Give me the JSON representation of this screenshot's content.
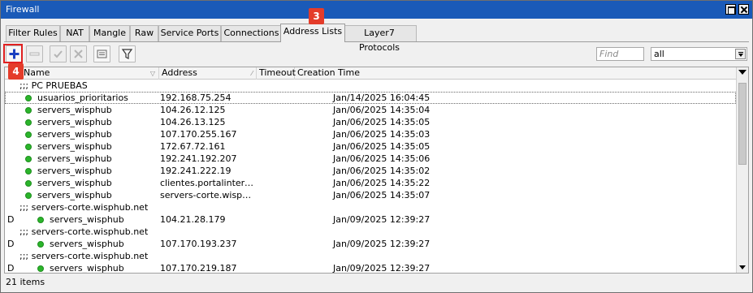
{
  "window": {
    "title": "Firewall"
  },
  "tabs": [
    {
      "label": "Filter Rules"
    },
    {
      "label": "NAT"
    },
    {
      "label": "Mangle"
    },
    {
      "label": "Raw"
    },
    {
      "label": "Service Ports"
    },
    {
      "label": "Connections"
    },
    {
      "label": "Address Lists",
      "active": true
    },
    {
      "label": "Layer7 Protocols"
    }
  ],
  "toolbar": {
    "find_placeholder": "Find",
    "filter_value": "all",
    "icons": [
      "add-icon",
      "remove-icon",
      "enable-icon",
      "disable-icon",
      "comment-icon",
      "filter-icon"
    ]
  },
  "annotations": {
    "tab_badge": "3",
    "add_badge": "4"
  },
  "table": {
    "columns": [
      "Name",
      "Address",
      "Timeout",
      "Creation Time"
    ],
    "rows": [
      {
        "type": "comment",
        "text": ";;; PC PRUEBAS"
      },
      {
        "flag": "",
        "name": "usuarios_prioritarios",
        "address": "192.168.75.254",
        "timeout": "",
        "created": "Jan/14/2025 16:04:45",
        "selected": true
      },
      {
        "flag": "",
        "name": "servers_wisphub",
        "address": "104.26.12.125",
        "timeout": "",
        "created": "Jan/06/2025 14:35:04"
      },
      {
        "flag": "",
        "name": "servers_wisphub",
        "address": "104.26.13.125",
        "timeout": "",
        "created": "Jan/06/2025 14:35:05"
      },
      {
        "flag": "",
        "name": "servers_wisphub",
        "address": "107.170.255.167",
        "timeout": "",
        "created": "Jan/06/2025 14:35:03"
      },
      {
        "flag": "",
        "name": "servers_wisphub",
        "address": "172.67.72.161",
        "timeout": "",
        "created": "Jan/06/2025 14:35:05"
      },
      {
        "flag": "",
        "name": "servers_wisphub",
        "address": "192.241.192.207",
        "timeout": "",
        "created": "Jan/06/2025 14:35:06"
      },
      {
        "flag": "",
        "name": "servers_wisphub",
        "address": "192.241.222.19",
        "timeout": "",
        "created": "Jan/06/2025 14:35:02"
      },
      {
        "flag": "",
        "name": "servers_wisphub",
        "address": "clientes.portalinternet....",
        "timeout": "",
        "created": "Jan/06/2025 14:35:22"
      },
      {
        "flag": "",
        "name": "servers_wisphub",
        "address": "servers-corte.wisphub....",
        "timeout": "",
        "created": "Jan/06/2025 14:35:07"
      },
      {
        "type": "comment",
        "text": ";;; servers-corte.wisphub.net"
      },
      {
        "flag": "D",
        "name": "servers_wisphub",
        "address": "104.21.28.179",
        "timeout": "",
        "created": "Jan/09/2025 12:39:27"
      },
      {
        "type": "comment",
        "text": ";;; servers-corte.wisphub.net"
      },
      {
        "flag": "D",
        "name": "servers_wisphub",
        "address": "107.170.193.237",
        "timeout": "",
        "created": "Jan/09/2025 12:39:27"
      },
      {
        "type": "comment",
        "text": ";;; servers-corte.wisphub.net"
      },
      {
        "flag": "D",
        "name": "servers_wisphub",
        "address": "107.170.219.187",
        "timeout": "",
        "created": "Jan/09/2025 12:39:27"
      }
    ]
  },
  "status": {
    "count_text": "21 items"
  },
  "colors": {
    "titlebar": "#1a5ab8",
    "enabled_dot": "#2bb52b",
    "badge": "#e43c2a",
    "add_icon": "#1a3fc0"
  }
}
